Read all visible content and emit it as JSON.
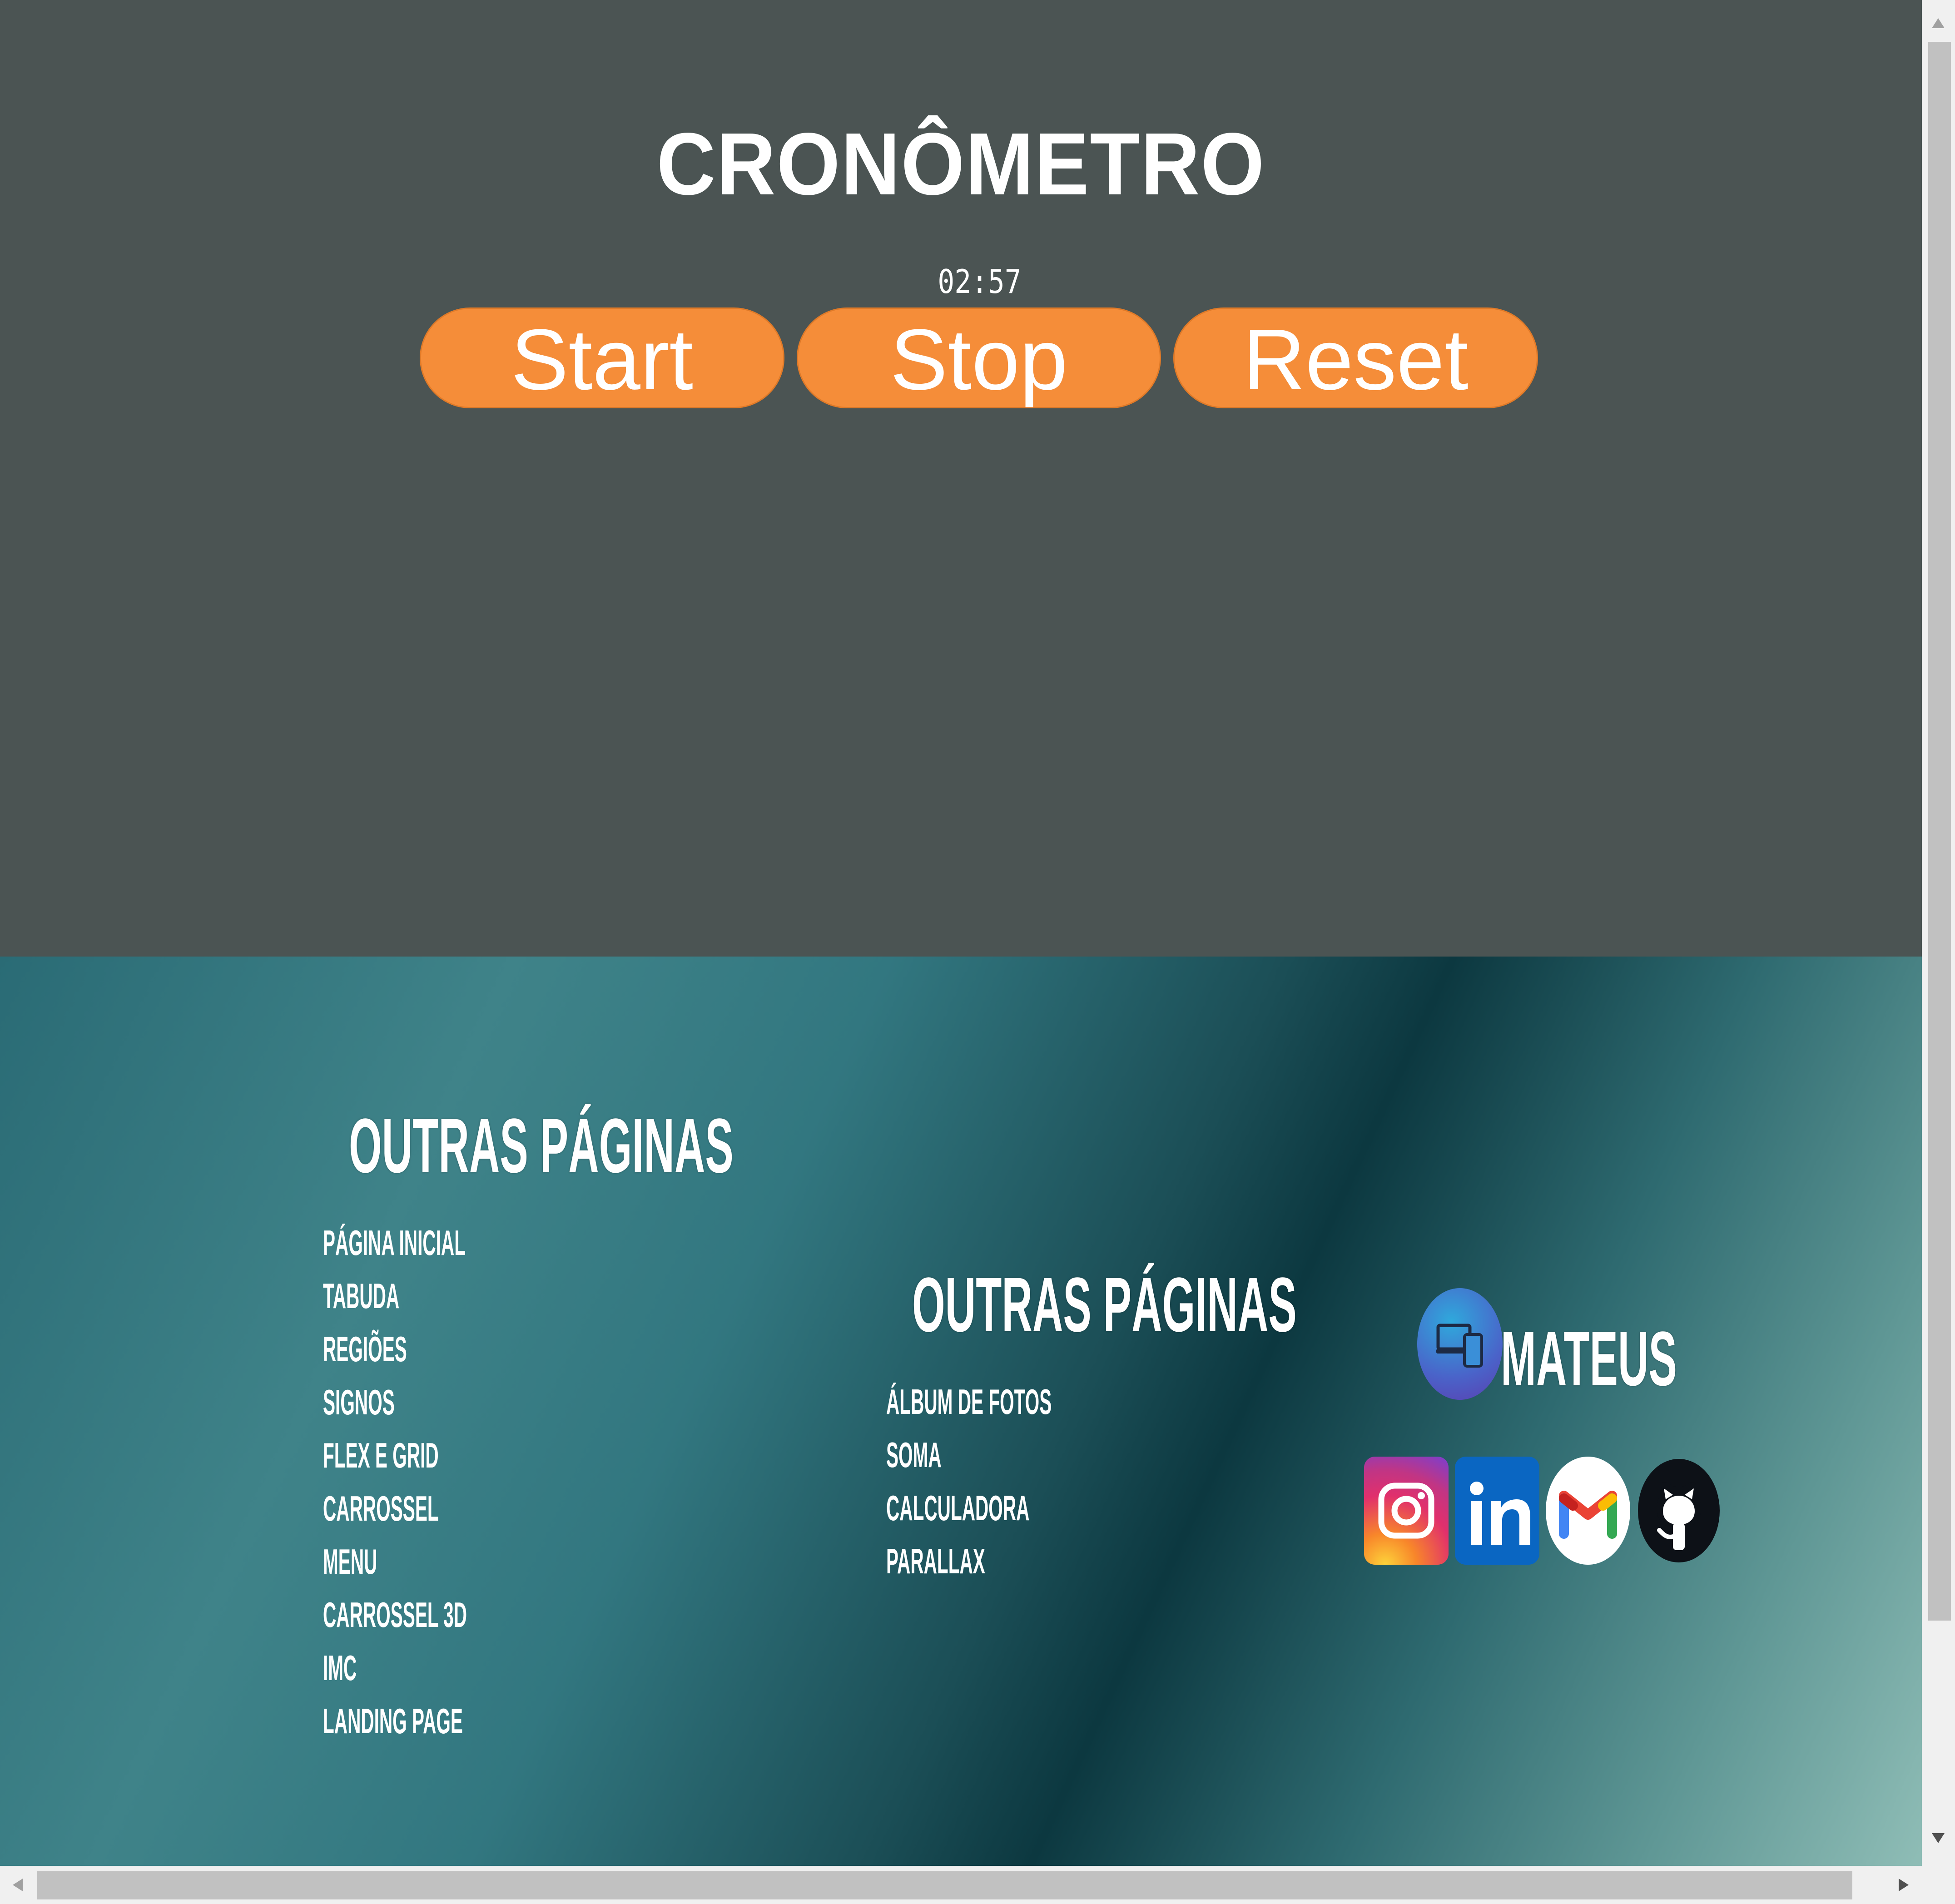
{
  "header": {
    "title": "CRONÔMETRO"
  },
  "stopwatch": {
    "time": "02:57",
    "buttons": {
      "start": "Start",
      "stop": "Stop",
      "reset": "Reset"
    },
    "accent_color": "#f58d39"
  },
  "footer": {
    "column1": {
      "heading": "OUTRAS PÁGINAS",
      "links": [
        "PÁGINA INICIAL",
        "TABUDA",
        "REGIÕES",
        "SIGNOS",
        "FLEX E GRID",
        "CARROSSEL",
        "MENU",
        "CARROSSEL 3D",
        "IMC",
        "LANDING PAGE"
      ]
    },
    "column2": {
      "heading": "OUTRAS PÁGINAS",
      "links": [
        "ÁLBUM DE FOTOS",
        "SOMA",
        "CALCULADORA",
        "PARALLAX"
      ]
    },
    "brand": {
      "name": "MATEUS",
      "logo_icon": "devices-icon"
    },
    "socials": [
      "instagram-icon",
      "linkedin-icon",
      "gmail-icon",
      "github-icon"
    ]
  }
}
